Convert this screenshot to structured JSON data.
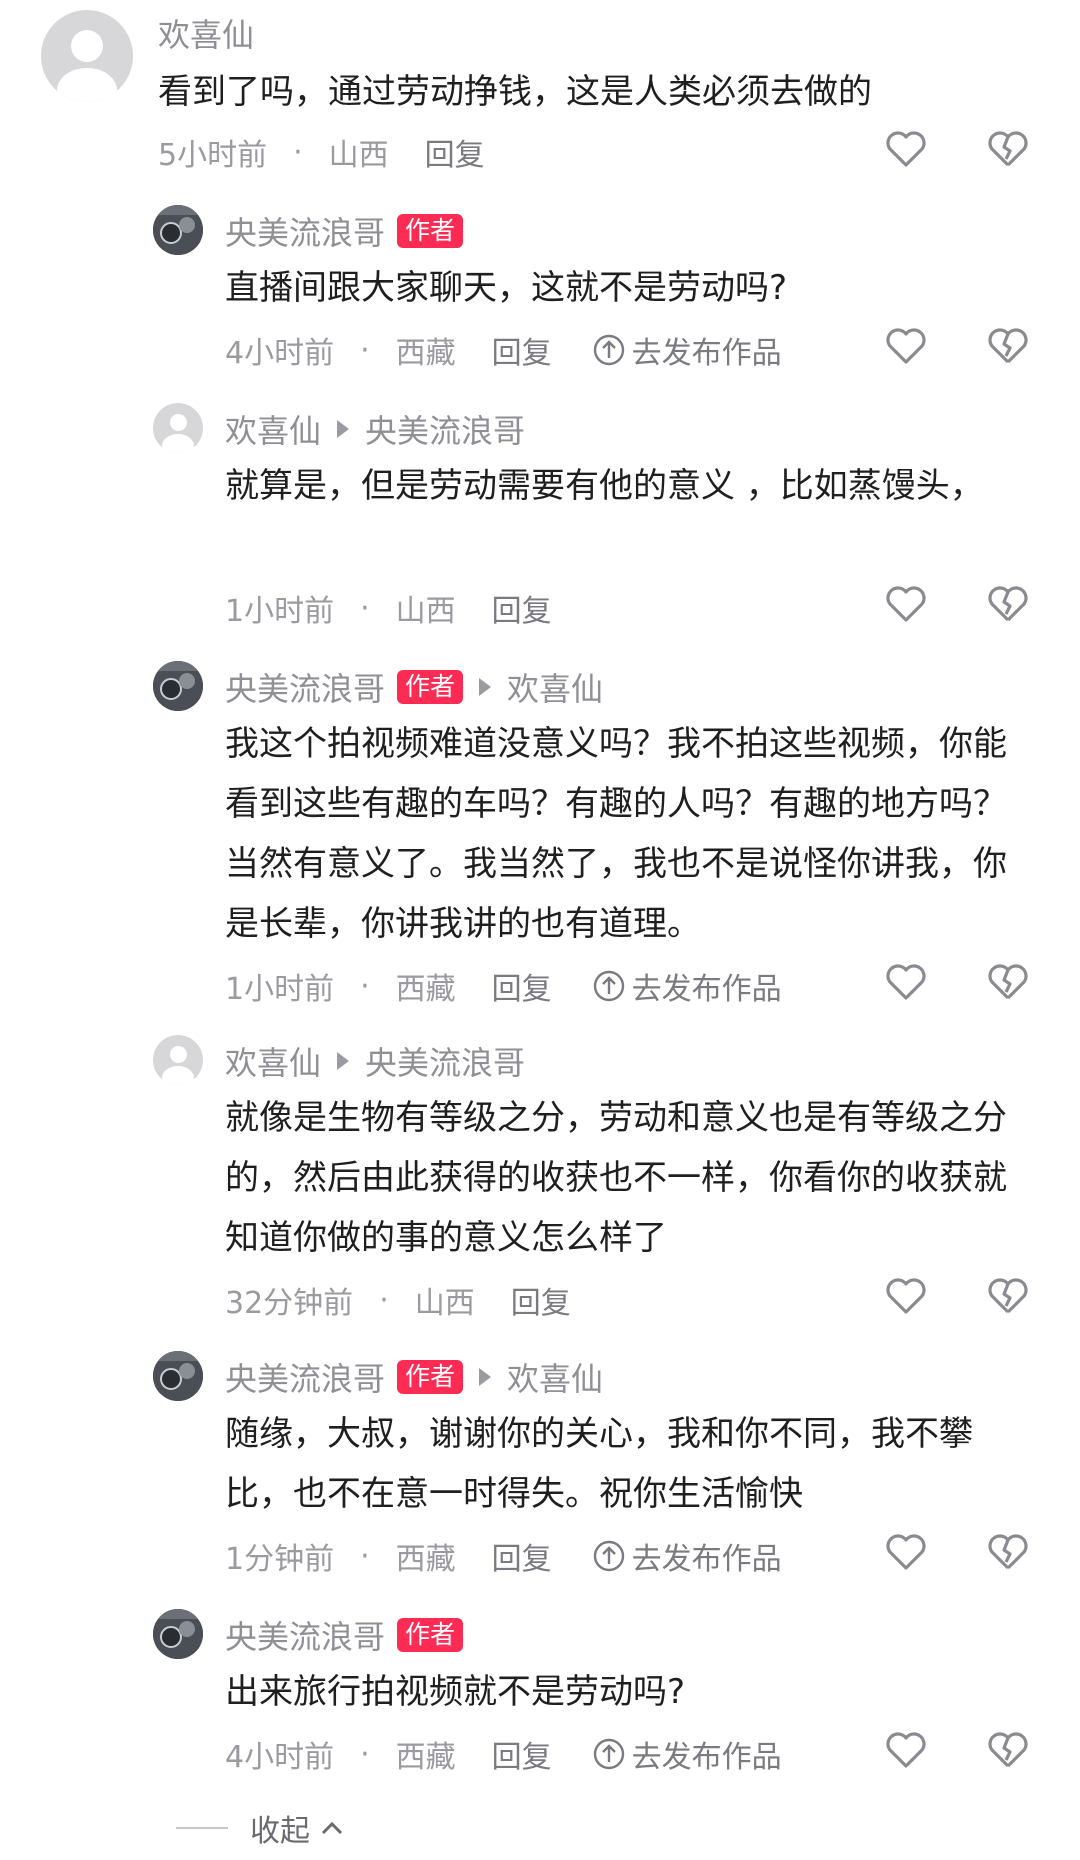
{
  "comments": [
    {
      "name": "欢喜仙",
      "badge": "",
      "reply_to": "",
      "text": "看到了吗，通过劳动挣钱，这是人类必须去做的",
      "time": "5小时前",
      "location": "山西",
      "reply": "回复",
      "publish": ""
    },
    {
      "name": "央美流浪哥",
      "badge": "作者",
      "reply_to": "",
      "text": "直播间跟大家聊天，这就不是劳动吗?",
      "time": "4小时前",
      "location": "西藏",
      "reply": "回复",
      "publish": "去发布作品"
    },
    {
      "name": "欢喜仙",
      "badge": "",
      "reply_to": "央美流浪哥",
      "text": "就算是，但是劳动需要有他的意义 ，比如蒸馒头，",
      "time": "1小时前",
      "location": "山西",
      "reply": "回复",
      "publish": ""
    },
    {
      "name": "央美流浪哥",
      "badge": "作者",
      "reply_to": "欢喜仙",
      "text": "我这个拍视频难道没意义吗？我不拍这些视频，你能看到这些有趣的车吗？有趣的人吗？有趣的地方吗？当然有意义了。我当然了，我也不是说怪你讲我，你是长辈，你讲我讲的也有道理。",
      "time": "1小时前",
      "location": "西藏",
      "reply": "回复",
      "publish": "去发布作品"
    },
    {
      "name": "欢喜仙",
      "badge": "",
      "reply_to": "央美流浪哥",
      "text": "就像是生物有等级之分，劳动和意义也是有等级之分的，然后由此获得的收获也不一样，你看你的收获就知道你做的事的意义怎么样了",
      "time": "32分钟前",
      "location": "山西",
      "reply": "回复",
      "publish": ""
    },
    {
      "name": "央美流浪哥",
      "badge": "作者",
      "reply_to": "欢喜仙",
      "text": "随缘，大叔，谢谢你的关心，我和你不同，我不攀比，也不在意一时得失。祝你生活愉快",
      "time": "1分钟前",
      "location": "西藏",
      "reply": "回复",
      "publish": "去发布作品"
    },
    {
      "name": "央美流浪哥",
      "badge": "作者",
      "reply_to": "",
      "text": "出来旅行拍视频就不是劳动吗?",
      "time": "4小时前",
      "location": "西藏",
      "reply": "回复",
      "publish": "去发布作品"
    }
  ],
  "collapse_label": "收起",
  "colors": {
    "badge": "#fe2c55",
    "muted": "#9a9aa0",
    "text": "#1f1f1f"
  },
  "icons": {
    "like": "heart-outline-icon",
    "dislike": "broken-heart-icon",
    "publish": "upload-circle-icon",
    "collapse": "chevron-up-icon"
  }
}
